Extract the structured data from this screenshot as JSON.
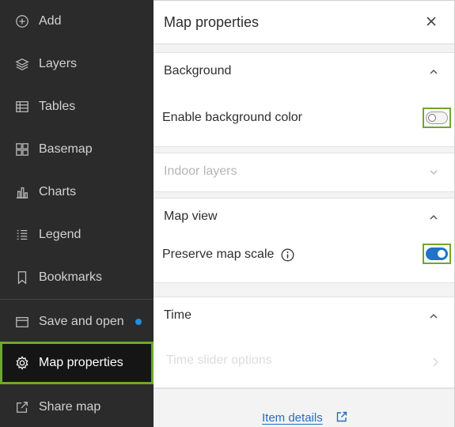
{
  "sidebar": {
    "items": [
      {
        "label": "Add",
        "icon": "add-circle-icon"
      },
      {
        "label": "Layers",
        "icon": "layers-icon"
      },
      {
        "label": "Tables",
        "icon": "table-icon"
      },
      {
        "label": "Basemap",
        "icon": "basemap-icon"
      },
      {
        "label": "Charts",
        "icon": "chart-icon"
      },
      {
        "label": "Legend",
        "icon": "legend-icon"
      },
      {
        "label": "Bookmarks",
        "icon": "bookmark-icon"
      },
      {
        "label": "Save and open",
        "icon": "folder-icon",
        "unsaved_indicator": true
      },
      {
        "label": "Map properties",
        "icon": "gear-icon",
        "active": true
      },
      {
        "label": "Share map",
        "icon": "share-icon"
      }
    ]
  },
  "panel": {
    "title": "Map properties",
    "sections": {
      "background": {
        "title": "Background",
        "expanded": true,
        "enable_bg_label": "Enable background color",
        "enable_bg_on": false
      },
      "indoor": {
        "title": "Indoor layers",
        "disabled": true
      },
      "map_view": {
        "title": "Map view",
        "expanded": true,
        "preserve_scale_label": "Preserve map scale",
        "preserve_scale_on": true
      },
      "time": {
        "title": "Time",
        "expanded": true,
        "slider_options_label": "Time slider options",
        "slider_options_disabled": true
      }
    },
    "footer": {
      "item_details_label": "Item details"
    }
  },
  "colors": {
    "sidebar_bg": "#2b2b2b",
    "highlight": "#6ea82c",
    "accent_blue": "#1f74c7",
    "dot_blue": "#1f8de0"
  }
}
